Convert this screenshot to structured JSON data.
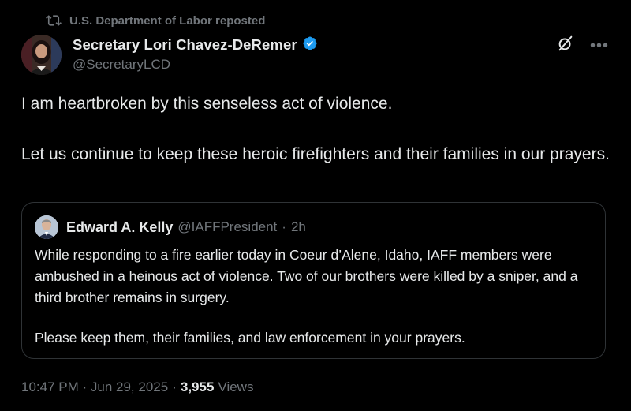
{
  "repost": {
    "icon": "repost-icon",
    "text": "U.S. Department of Labor reposted"
  },
  "tweet": {
    "author_name": "Secretary Lori Chavez-DeRemer",
    "handle": "@SecretaryLCD",
    "verified_icon": "verified-badge-icon",
    "paragraphs": [
      "I am heartbroken by this senseless act of violence.",
      "Let us continue to keep these heroic firefighters and their families in our prayers."
    ],
    "timestamp": "10:47 PM · Jun 29, 2025",
    "separator": "·",
    "views_count": "3,955",
    "views_label": "Views"
  },
  "quote": {
    "author_name": "Edward A. Kelly",
    "handle": "@IAFFPresident",
    "separator": "·",
    "time": "2h",
    "paragraphs": [
      "While responding to a fire earlier today in Coeur d’Alene, Idaho, IAFF members were ambushed in a heinous act of violence. Two of our brothers were killed by a sniper, and a third brother remains in surgery.",
      "Please keep them, their families, and law enforcement in your prayers."
    ]
  },
  "actions": {
    "grok_icon": "grok-icon",
    "more_icon": "more-options-icon"
  },
  "colors": {
    "background": "#000000",
    "primary_text": "#e7e9ea",
    "secondary_text": "#71767b",
    "verified_blue": "#1d9bf0",
    "border": "#2f3336"
  }
}
